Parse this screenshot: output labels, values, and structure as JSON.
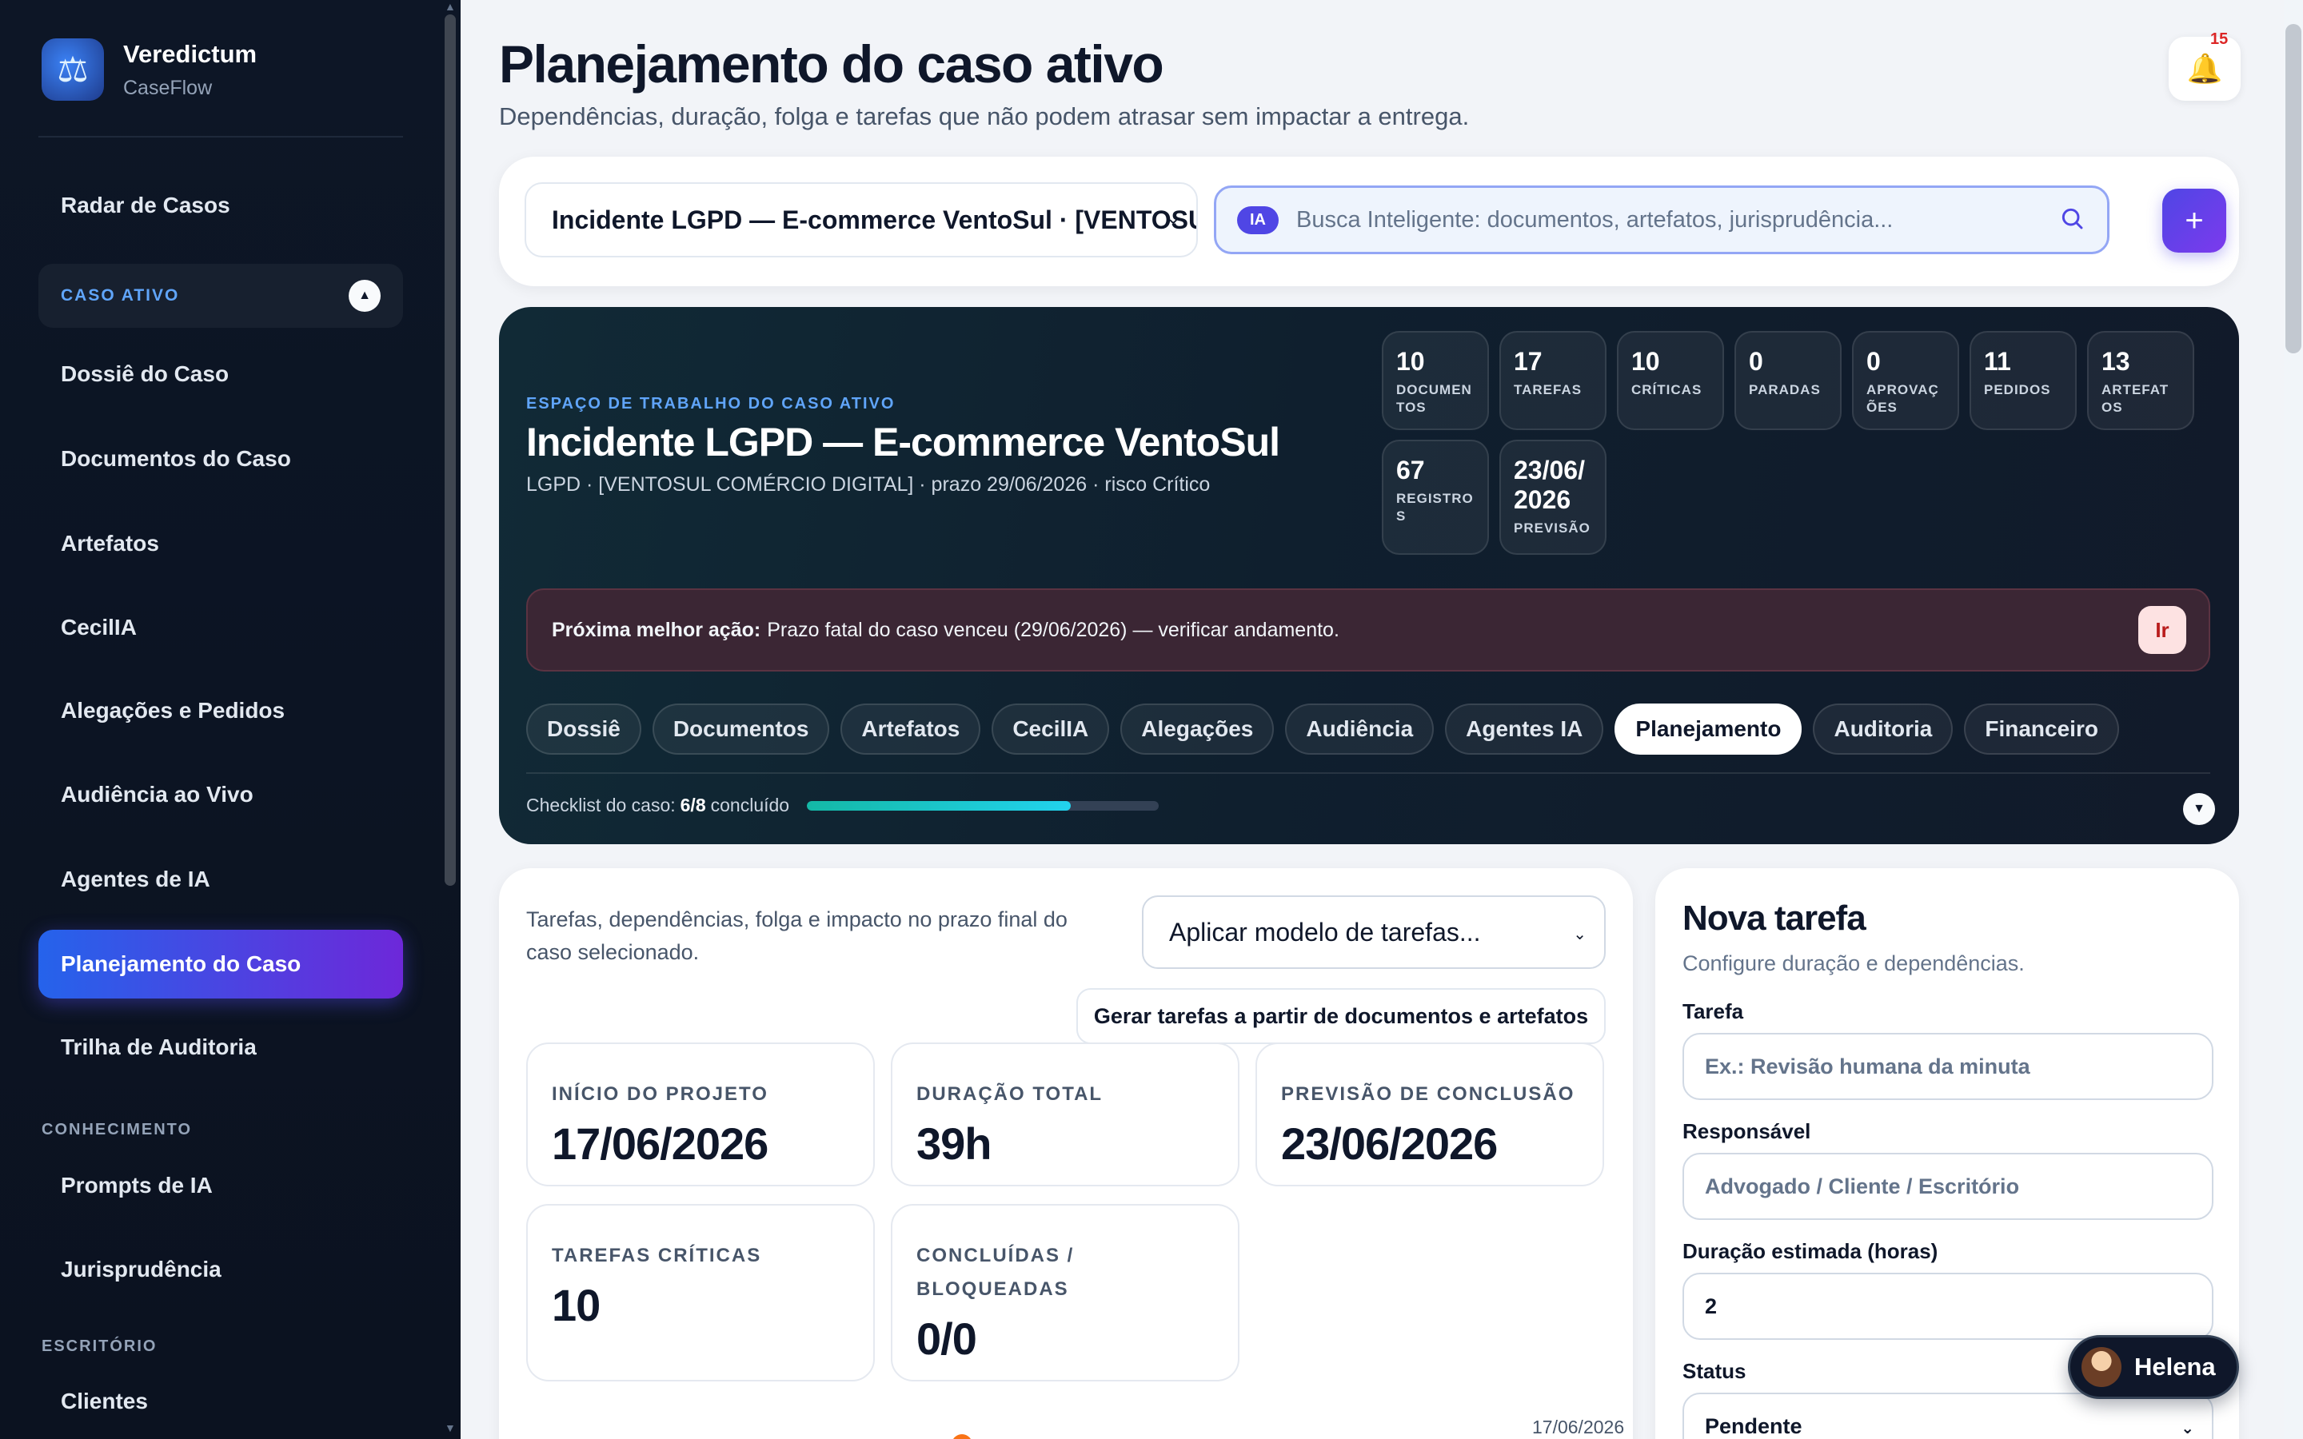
{
  "sidebar": {
    "brand": {
      "name": "Veredictum",
      "sub": "CaseFlow"
    },
    "top_item": "Radar de Casos",
    "group_label": "CASO ATIVO",
    "case_items": [
      "Dossiê do Caso",
      "Documentos do Caso",
      "Artefatos",
      "CecilIA",
      "Alegações e Pedidos",
      "Audiência ao Vivo",
      "Agentes de IA",
      "Planejamento do Caso",
      "Trilha de Auditoria"
    ],
    "active_item": "Planejamento do Caso",
    "section_knowledge": "CONHECIMENTO",
    "knowledge_items": [
      "Prompts de IA",
      "Jurisprudência"
    ],
    "section_office": "ESCRITÓRIO",
    "office_items": [
      "Clientes"
    ]
  },
  "header": {
    "title": "Planejamento do caso ativo",
    "subtitle": "Dependências, duração, folga e tarefas que não podem atrasar sem impactar a entrega.",
    "notifications": "15"
  },
  "toolbar": {
    "case_select": "Incidente LGPD — E-commerce VentoSul · [VENTOSUL COMÉRCIO DIGITAL]",
    "ia_badge": "IA",
    "search_placeholder": "Busca Inteligente: documentos, artefatos, jurisprudência...",
    "add_label": "+"
  },
  "workspace": {
    "eyebrow": "ESPAÇO DE TRABALHO DO CASO ATIVO",
    "title": "Incidente LGPD — E-commerce VentoSul",
    "meta": "LGPD · [VENTOSUL COMÉRCIO DIGITAL] · prazo 29/06/2026 · risco Crítico",
    "stats": [
      {
        "value": "10",
        "label": "DOCUMENTOS"
      },
      {
        "value": "17",
        "label": "TAREFAS"
      },
      {
        "value": "10",
        "label": "CRÍTICAS"
      },
      {
        "value": "0",
        "label": "PARADAS"
      },
      {
        "value": "0",
        "label": "APROVAÇÕES"
      },
      {
        "value": "11",
        "label": "PEDIDOS"
      },
      {
        "value": "13",
        "label": "ARTEFATOS"
      },
      {
        "value": "67",
        "label": "REGISTROS"
      },
      {
        "value": "23/06/2026",
        "label": "PREVISÃO"
      }
    ],
    "next_action_label": "Próxima melhor ação:",
    "next_action_text": "Prazo fatal do caso venceu (29/06/2026) — verificar andamento.",
    "go_label": "Ir",
    "tabs": [
      "Dossiê",
      "Documentos",
      "Artefatos",
      "CecilIA",
      "Alegações",
      "Audiência",
      "Agentes IA",
      "Planejamento",
      "Auditoria",
      "Financeiro"
    ],
    "active_tab": "Planejamento",
    "checklist_label": "Checklist do caso:",
    "checklist_value": "6/8",
    "checklist_suffix": "concluído",
    "checklist_progress": 0.75
  },
  "planning": {
    "description": "Tarefas, dependências, folga e impacto no prazo final do caso selecionado.",
    "template_select": "Aplicar modelo de tarefas...",
    "generate_button": "Gerar tarefas a partir de documentos e artefatos",
    "kpis": [
      {
        "label": "INÍCIO DO PROJETO",
        "value": "17/06/2026"
      },
      {
        "label": "DURAÇÃO TOTAL",
        "value": "39h"
      },
      {
        "label": "PREVISÃO DE CONCLUSÃO",
        "value": "23/06/2026"
      },
      {
        "label": "TAREFAS CRÍTICAS",
        "value": "10"
      },
      {
        "label": "CONCLUÍDAS / BLOQUEADAS",
        "value": "0/0"
      }
    ],
    "gantt_date": "17/06/2026 –"
  },
  "new_task": {
    "title": "Nova tarefa",
    "subtitle": "Configure duração e dependências.",
    "task_label": "Tarefa",
    "task_placeholder": "Ex.: Revisão humana da minuta",
    "owner_label": "Responsável",
    "owner_placeholder": "Advogado / Cliente / Escritório",
    "duration_label": "Duração estimada (horas)",
    "duration_value": "2",
    "status_label": "Status",
    "status_value": "Pendente"
  },
  "assistant": {
    "name": "Helena"
  }
}
